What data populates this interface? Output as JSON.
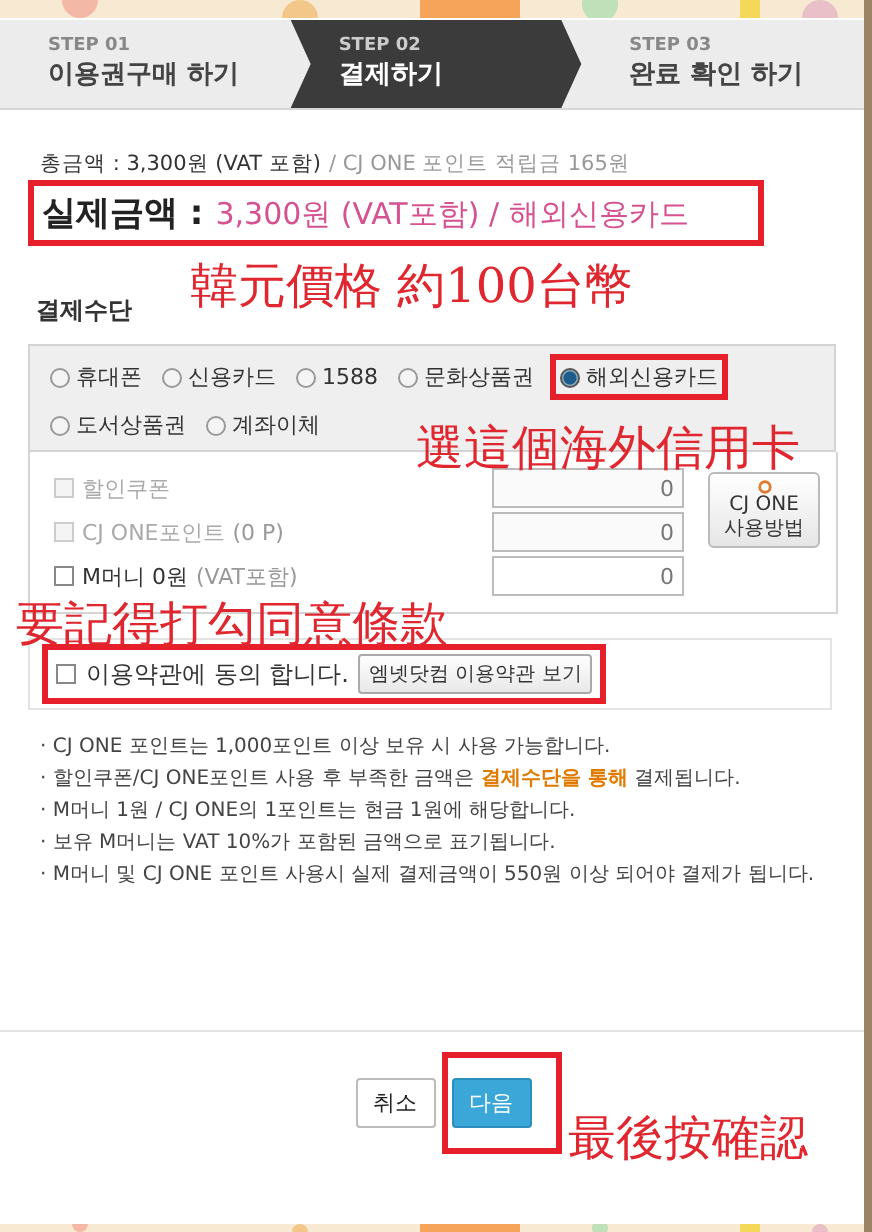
{
  "steps": [
    {
      "number": "STEP 01",
      "label": "이용권구매 하기",
      "selected": false
    },
    {
      "number": "STEP 02",
      "label": "결제하기",
      "selected": true
    },
    {
      "number": "STEP 03",
      "label": "완료 확인 하기",
      "selected": false
    }
  ],
  "summary": {
    "total": "총금액 : 3,300원 (VAT 포함)",
    "points": "/ CJ ONE 포인트 적립금 165원",
    "actual_label": "실제금액 :",
    "actual_value": "3,300원 (VAT포함) / 해외신용카드",
    "highlighted": true
  },
  "payment_method": {
    "title": "결제수단",
    "options": [
      {
        "label": "휴대폰",
        "selected": false,
        "highlighted": false
      },
      {
        "label": "신용카드",
        "selected": false,
        "highlighted": false
      },
      {
        "label": "1588",
        "selected": false,
        "highlighted": false
      },
      {
        "label": "문화상품권",
        "selected": false,
        "highlighted": false
      },
      {
        "label": "해외신용카드",
        "selected": true,
        "highlighted": true
      },
      {
        "label": "도서상품권",
        "selected": false,
        "highlighted": false
      },
      {
        "label": "계좌이체",
        "selected": false,
        "highlighted": false
      }
    ]
  },
  "discounts": [
    {
      "label": "할인쿠폰",
      "checked": false,
      "disabled": true,
      "value": "0"
    },
    {
      "label": "CJ ONE포인트",
      "note": "(0 P)",
      "checked": false,
      "disabled": true,
      "value": "0"
    },
    {
      "label": "M머니 0원",
      "note": "(VAT포함)",
      "checked": false,
      "disabled": false,
      "value": "0"
    }
  ],
  "cj_one_button": {
    "lines": [
      "CJ ONE",
      "사용방법"
    ]
  },
  "agreement": {
    "label": "이용약관에 동의 합니다.",
    "checked": false,
    "button": "엠넷닷컴 이용약관 보기",
    "highlighted": true
  },
  "notes": [
    "· CJ ONE 포인트는 1,000포인트 이상 보유 시 사용 가능합니다.",
    "· 할인쿠폰/CJ ONE포인트 사용 후 부족한 금액은 **결제수단을 통해** 결제됩니다.",
    "· M머니 1원 / CJ ONE의 1포인트는 현금 1원에 해당합니다.",
    "· 보유 M머니는 VAT 10%가 포함된 금액으로 표기됩니다.",
    "· M머니 및 CJ ONE 포인트 사용시 실제 결제금액이 550원 이상 되어야 결제가 됩니다."
  ],
  "buttons": [
    {
      "label": "취소",
      "kind": "secondary",
      "highlighted": false
    },
    {
      "label": "다음",
      "kind": "primary",
      "highlighted": true
    }
  ],
  "annotations": [
    {
      "text": "韓元價格  約100台幣"
    },
    {
      "text": "選這個海外信用卡"
    },
    {
      "text": "要記得打勾同意條款"
    },
    {
      "text": "最後按確認"
    }
  ]
}
